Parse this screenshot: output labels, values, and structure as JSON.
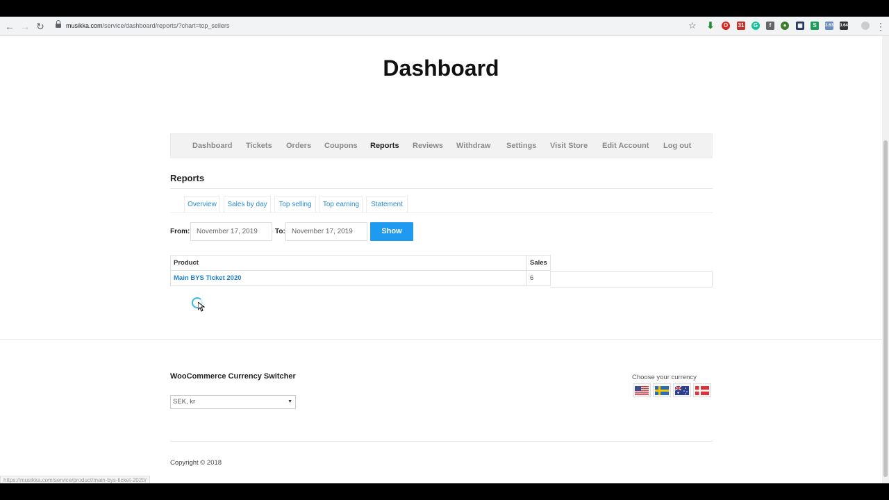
{
  "browser": {
    "url_domain": "musikka.com",
    "url_path": "/service/dashboard/reports/?chart=top_sellers",
    "status_url": "https://musikka.com/service/product/main-bys-ticket-2020/",
    "ext_badge_1": "3.63",
    "ext_badge_2": "3.64"
  },
  "page": {
    "title": "Dashboard"
  },
  "nav": {
    "items": [
      {
        "label": "Dashboard"
      },
      {
        "label": "Tickets"
      },
      {
        "label": "Orders"
      },
      {
        "label": "Coupons"
      },
      {
        "label": "Reports",
        "active": true
      },
      {
        "label": "Reviews"
      },
      {
        "label": "Withdraw"
      },
      {
        "label": "Settings"
      },
      {
        "label": "Visit Store"
      },
      {
        "label": "Edit Account"
      },
      {
        "label": "Log out"
      }
    ]
  },
  "reports": {
    "title": "Reports",
    "tabs": [
      {
        "label": "Overview"
      },
      {
        "label": "Sales by day"
      },
      {
        "label": "Top selling"
      },
      {
        "label": "Top earning"
      },
      {
        "label": "Statement"
      }
    ],
    "from_label": "From:",
    "from_value": "November 17, 2019",
    "to_label": "To:",
    "to_value": "November 17, 2019",
    "show_label": "Show",
    "table": {
      "columns": [
        "Product",
        "Sales"
      ],
      "rows": [
        {
          "product": "Main BYS Ticket 2020",
          "sales": "6"
        }
      ]
    }
  },
  "footer": {
    "widget_title": "WooCommerce Currency Switcher",
    "currency_selected": "SEK, kr",
    "choose_currency": "Choose your currency",
    "flags": [
      "us-flag-icon",
      "sweden-flag-icon",
      "australia-flag-icon",
      "denmark-flag-icon"
    ],
    "copyright": "Copyright © 2018"
  },
  "colors": {
    "accent": "#1e9af1",
    "link": "#2a8bd1"
  }
}
